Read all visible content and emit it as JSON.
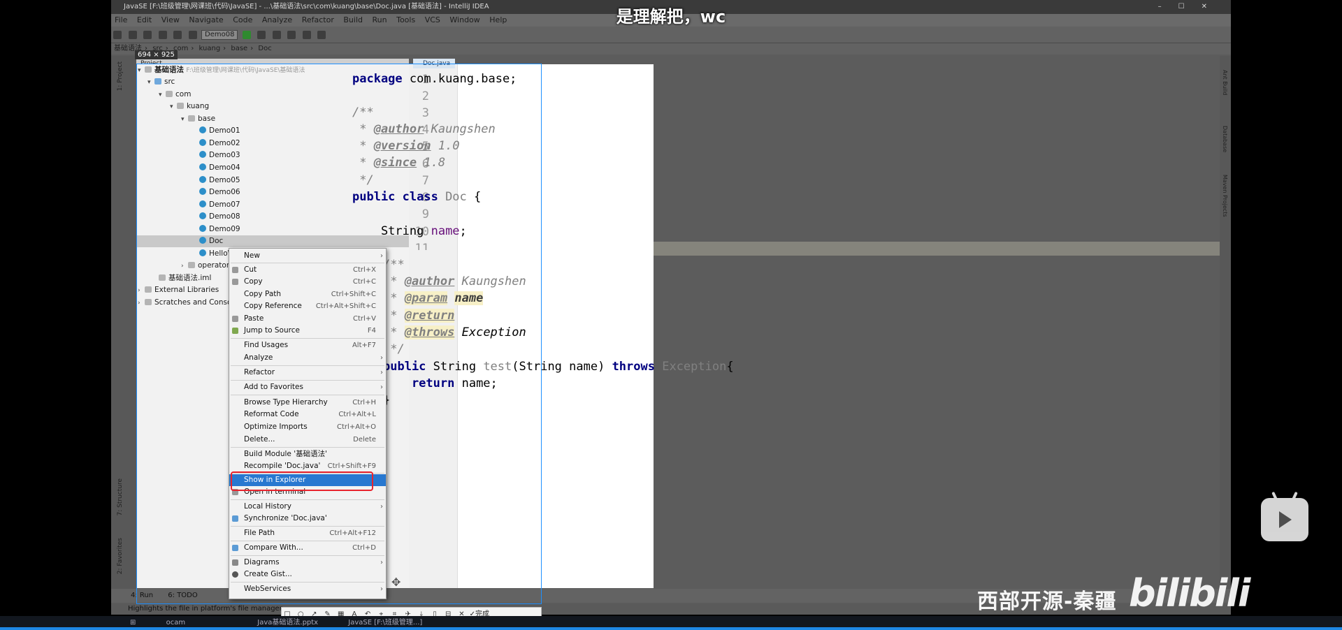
{
  "subtitle": "是理解把，wc",
  "window": {
    "title": "JavaSE [F:\\班级管理\\网课班\\代码\\JavaSE] - ...\\基础语法\\src\\com\\kuang\\base\\Doc.java [基础语法] - IntelliJ IDEA"
  },
  "menu": [
    "File",
    "Edit",
    "View",
    "Navigate",
    "Code",
    "Analyze",
    "Refactor",
    "Build",
    "Run",
    "Tools",
    "VCS",
    "Window",
    "Help"
  ],
  "toolbar": {
    "run_config": "Demo08"
  },
  "breadcrumb": [
    "基础语法",
    "src",
    "com",
    "kuang",
    "base",
    "Doc"
  ],
  "selection_size": "694 × 925",
  "project": {
    "header": "Project",
    "root_label": "基础语法",
    "root_path": "F:\\班级管理\\网课班\\代码\\JavaSE\\基础语法",
    "src": "src",
    "com": "com",
    "kuang": "kuang",
    "base": "base",
    "classes": [
      "Demo01",
      "Demo02",
      "Demo03",
      "Demo04",
      "Demo05",
      "Demo06",
      "Demo07",
      "Demo08",
      "Demo09",
      "Doc",
      "HelloWorld"
    ],
    "operator": "operator",
    "iml": "基础语法.iml",
    "external": "External Libraries",
    "scratches": "Scratches and Consoles"
  },
  "editor": {
    "tab": "Doc.java",
    "line_numbers": [
      "1",
      "2",
      "3",
      "4",
      "5",
      "6",
      "7",
      "8",
      "9",
      "10",
      "11"
    ],
    "l1_kw": "package",
    "l1_rest": " com.kuang.base;",
    "l3": "/**",
    "l4_star": " * ",
    "l4_tag": "@author",
    "l4_val": " Kaungshen",
    "l5_star": " * ",
    "l5_tag": "@version",
    "l5_val": " 1.0",
    "l6_star": " * ",
    "l6_tag": "@since",
    "l6_val": " 1.8",
    "l7": " */",
    "l8_kw": "public class",
    "l8_cls": " Doc",
    "l8_rest": " {",
    "l10_type": "    String ",
    "l10_fld": "name",
    "l10_rest": ";",
    "m1": "/**",
    "m2_star": " * ",
    "m2_tag": "@author",
    "m2_val": " Kaungshen",
    "m3_star": " * ",
    "m3_tag": "@param",
    "m3_name": "name",
    "m4_star": " * ",
    "m4_tag": "@return",
    "m5_star": " * ",
    "m5_tag": "@throws",
    "m5_val": " Exception",
    "m6": " */",
    "m7_kw": "public",
    "m7_type": " String ",
    "m7_fn": "test",
    "m7_args": "(String name) ",
    "m7_kw2": "throws",
    "m7_ex": " Exception",
    "m7_brace": "{",
    "m8_kw": "    return",
    "m8_rest": " name;",
    "m9": "}"
  },
  "context_menu": {
    "items": [
      {
        "label": "New",
        "shortcut": "",
        "submenu": true
      },
      {
        "label": "Cut",
        "shortcut": "Ctrl+X"
      },
      {
        "label": "Copy",
        "shortcut": "Ctrl+C"
      },
      {
        "label": "Copy Path",
        "shortcut": "Ctrl+Shift+C"
      },
      {
        "label": "Copy Reference",
        "shortcut": "Ctrl+Alt+Shift+C"
      },
      {
        "label": "Paste",
        "shortcut": "Ctrl+V"
      },
      {
        "label": "Jump to Source",
        "shortcut": "F4"
      },
      {
        "label": "Find Usages",
        "shortcut": "Alt+F7"
      },
      {
        "label": "Analyze",
        "shortcut": "",
        "submenu": true
      },
      {
        "label": "Refactor",
        "shortcut": "",
        "submenu": true
      },
      {
        "label": "Add to Favorites",
        "shortcut": "",
        "submenu": true
      },
      {
        "label": "Browse Type Hierarchy",
        "shortcut": "Ctrl+H"
      },
      {
        "label": "Reformat Code",
        "shortcut": "Ctrl+Alt+L"
      },
      {
        "label": "Optimize Imports",
        "shortcut": "Ctrl+Alt+O"
      },
      {
        "label": "Delete...",
        "shortcut": "Delete"
      },
      {
        "label": "Build Module '基础语法'",
        "shortcut": ""
      },
      {
        "label": "Recompile 'Doc.java'",
        "shortcut": "Ctrl+Shift+F9"
      },
      {
        "label": "Show in Explorer",
        "shortcut": ""
      },
      {
        "label": "Open in terminal",
        "shortcut": ""
      },
      {
        "label": "Local History",
        "shortcut": "",
        "submenu": true
      },
      {
        "label": "Synchronize 'Doc.java'",
        "shortcut": ""
      },
      {
        "label": "File Path",
        "shortcut": "Ctrl+Alt+F12"
      },
      {
        "label": "Compare With...",
        "shortcut": "Ctrl+D"
      },
      {
        "label": "Diagrams",
        "shortcut": "",
        "submenu": true
      },
      {
        "label": "Create Gist...",
        "shortcut": ""
      },
      {
        "label": "WebServices",
        "shortcut": "",
        "submenu": true
      }
    ]
  },
  "bottom": {
    "run_tab": "4: Run",
    "todo_tab": "6: TODO",
    "status": "Highlights the file in platform's file manager",
    "snap_done": "完成"
  },
  "side_labels": {
    "project": "1: Project",
    "structure": "7: Structure",
    "favorites": "2: Favorites",
    "ant": "Ant Build",
    "database": "Database",
    "maven": "Maven Projects"
  },
  "watermark": "西部开源-秦疆",
  "logo": "bilibili",
  "taskbar": {
    "item1": "ocam",
    "item2": "Java基础语法.pptx",
    "item3": "JavaSE [F:\\班级管理...]"
  },
  "colors": {
    "highlight": "#2878d0",
    "annotation_box": "#e8232d",
    "selection_border": "#1e90ff"
  }
}
